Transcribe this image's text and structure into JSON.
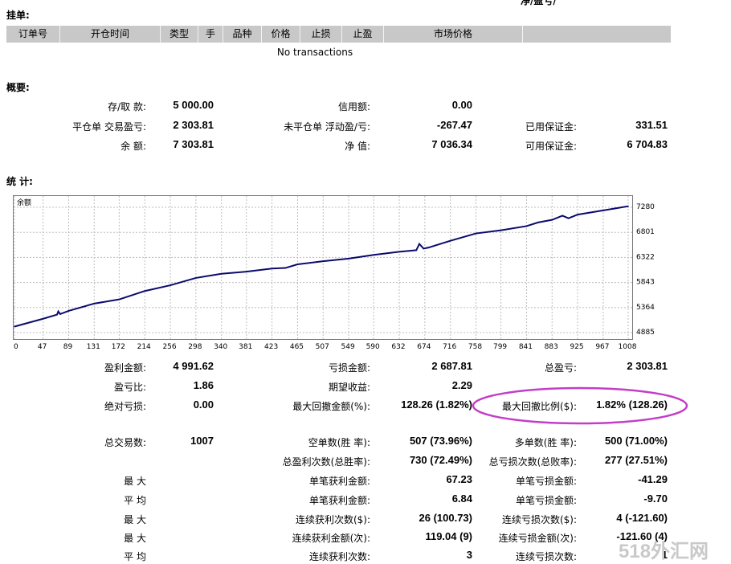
{
  "top_cut_text": "净/盈亏/",
  "pending": {
    "title": "挂单:",
    "headers": [
      "订单号",
      "开仓时间",
      "类型",
      "手",
      "品种",
      "价格",
      "止损",
      "止盈",
      "市场价格",
      ""
    ],
    "empty_text": "No transactions"
  },
  "summary": {
    "title": "概要:",
    "rows": [
      [
        {
          "label": "存/取 款:",
          "value": "5 000.00"
        },
        {
          "label": "信用额:",
          "value": "0.00"
        },
        {
          "label": "",
          "value": ""
        }
      ],
      [
        {
          "label": "平仓单 交易盈亏:",
          "value": "2 303.81"
        },
        {
          "label": "未平仓单 浮动盈/亏:",
          "value": "-267.47"
        },
        {
          "label": "已用保证金:",
          "value": "331.51"
        }
      ],
      [
        {
          "label": "余 额:",
          "value": "7 303.81"
        },
        {
          "label": "净 值:",
          "value": "7 036.34"
        },
        {
          "label": "可用保证金:",
          "value": "6 704.83"
        }
      ]
    ]
  },
  "stats": {
    "title": "统 计:",
    "rows": [
      [
        {
          "label": "盈利金额:",
          "value": "4 991.62"
        },
        {
          "label": "亏损金额:",
          "value": "2 687.81"
        },
        {
          "label": "总盈亏:",
          "value": "2 303.81"
        }
      ],
      [
        {
          "label": "盈亏比:",
          "value": "1.86"
        },
        {
          "label": "期望收益:",
          "value": "2.29"
        },
        {
          "label": "",
          "value": ""
        }
      ],
      [
        {
          "label": "绝对亏损:",
          "value": "0.00"
        },
        {
          "label": "最大回撤金额(%):",
          "value": "128.26 (1.82%)"
        },
        {
          "label": "最大回撤比例($):",
          "value": "1.82% (128.26)"
        }
      ],
      [
        {
          "label": "",
          "value": ""
        },
        {
          "label": "",
          "value": ""
        },
        {
          "label": "",
          "value": ""
        }
      ],
      [
        {
          "label": "总交易数:",
          "value": "1007"
        },
        {
          "label": "空单数(胜 率):",
          "value": "507 (73.96%)"
        },
        {
          "label": "多单数(胜 率):",
          "value": "500 (71.00%)"
        }
      ],
      [
        {
          "label": "",
          "value": ""
        },
        {
          "label": "总盈利次数(总胜率):",
          "value": "730 (72.49%)"
        },
        {
          "label": "总亏损次数(总败率):",
          "value": "277 (27.51%)"
        }
      ],
      [
        {
          "label": "最 大",
          "value": ""
        },
        {
          "label": "单笔获利金额:",
          "value": "67.23"
        },
        {
          "label": "单笔亏损金额:",
          "value": "-41.29"
        }
      ],
      [
        {
          "label": "平 均",
          "value": ""
        },
        {
          "label": "单笔获利金额:",
          "value": "6.84"
        },
        {
          "label": "单笔亏损金额:",
          "value": "-9.70"
        }
      ],
      [
        {
          "label": "最 大",
          "value": ""
        },
        {
          "label": "连续获利次数($):",
          "value": "26 (100.73)"
        },
        {
          "label": "连续亏损次数($):",
          "value": "4 (-121.60)"
        }
      ],
      [
        {
          "label": "最 大",
          "value": ""
        },
        {
          "label": "连续获利金额(次):",
          "value": "119.04 (9)"
        },
        {
          "label": "连续亏损金额(次):",
          "value": "-121.60 (4)"
        }
      ],
      [
        {
          "label": "平 均",
          "value": ""
        },
        {
          "label": "连续获利次数:",
          "value": "3"
        },
        {
          "label": "连续亏损次数:",
          "value": "1"
        }
      ]
    ]
  },
  "highlight_color": "#c23ec8",
  "chart_data": {
    "type": "line",
    "title": "余额",
    "x_ticks": [
      "0",
      "47",
      "89",
      "131",
      "172",
      "214",
      "256",
      "298",
      "340",
      "381",
      "423",
      "465",
      "507",
      "549",
      "590",
      "632",
      "674",
      "716",
      "758",
      "799",
      "841",
      "883",
      "925",
      "967",
      "1008"
    ],
    "y_ticks": [
      "7280",
      "6801",
      "6322",
      "5843",
      "5364",
      "4885"
    ],
    "ylim": [
      4885,
      7280
    ],
    "xlim": [
      0,
      1008
    ],
    "grid": true,
    "line_color": "#0a0a6e",
    "series": [
      {
        "name": "",
        "x": [
          0,
          47,
          70,
          72,
          75,
          89,
          131,
          172,
          214,
          256,
          298,
          340,
          381,
          423,
          445,
          465,
          507,
          549,
          590,
          632,
          660,
          665,
          672,
          680,
          716,
          758,
          799,
          841,
          860,
          883,
          900,
          910,
          925,
          967,
          1008
        ],
        "y": [
          5000,
          5150,
          5230,
          5290,
          5240,
          5300,
          5440,
          5520,
          5680,
          5790,
          5930,
          6010,
          6050,
          6110,
          6120,
          6190,
          6250,
          6300,
          6370,
          6430,
          6460,
          6580,
          6490,
          6510,
          6640,
          6780,
          6840,
          6920,
          6990,
          7040,
          7120,
          7070,
          7140,
          7220,
          7300
        ]
      }
    ]
  }
}
